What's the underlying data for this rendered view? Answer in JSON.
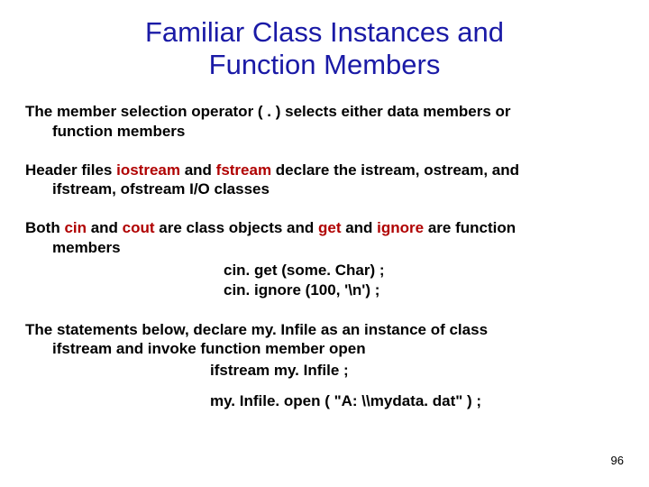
{
  "title_line1": "Familiar Class Instances and",
  "title_line2": "Function Members",
  "p1_a": "The member selection operator ( . ) selects either data members or",
  "p1_b": "function members",
  "p2_a_pre": "Header files ",
  "p2_a_r1": "iostream",
  "p2_a_mid": " and ",
  "p2_a_r2": "fstream",
  "p2_a_post": " declare the istream, ostream, and",
  "p2_b": "ifstream, ofstream I/O classes",
  "p3_a_1": "Both ",
  "p3_a_r1": "cin",
  "p3_a_2": " and ",
  "p3_a_r2": "cout",
  "p3_a_3": " are class objects and ",
  "p3_a_r3": "get",
  "p3_a_4": " and ",
  "p3_a_r4": "ignore",
  "p3_a_5": " are function",
  "p3_b": "members",
  "code1": "cin. get (some. Char) ;",
  "code2": "cin. ignore (100, '\\n') ;",
  "p4_a": "The statements below, declare my. Infile as an instance of class",
  "p4_b": "ifstream and invoke function member open",
  "code3": "ifstream  my. Infile ;",
  "code4": "my. Infile. open ( \"A: \\\\mydata. dat\" ) ;",
  "page_number": "96"
}
